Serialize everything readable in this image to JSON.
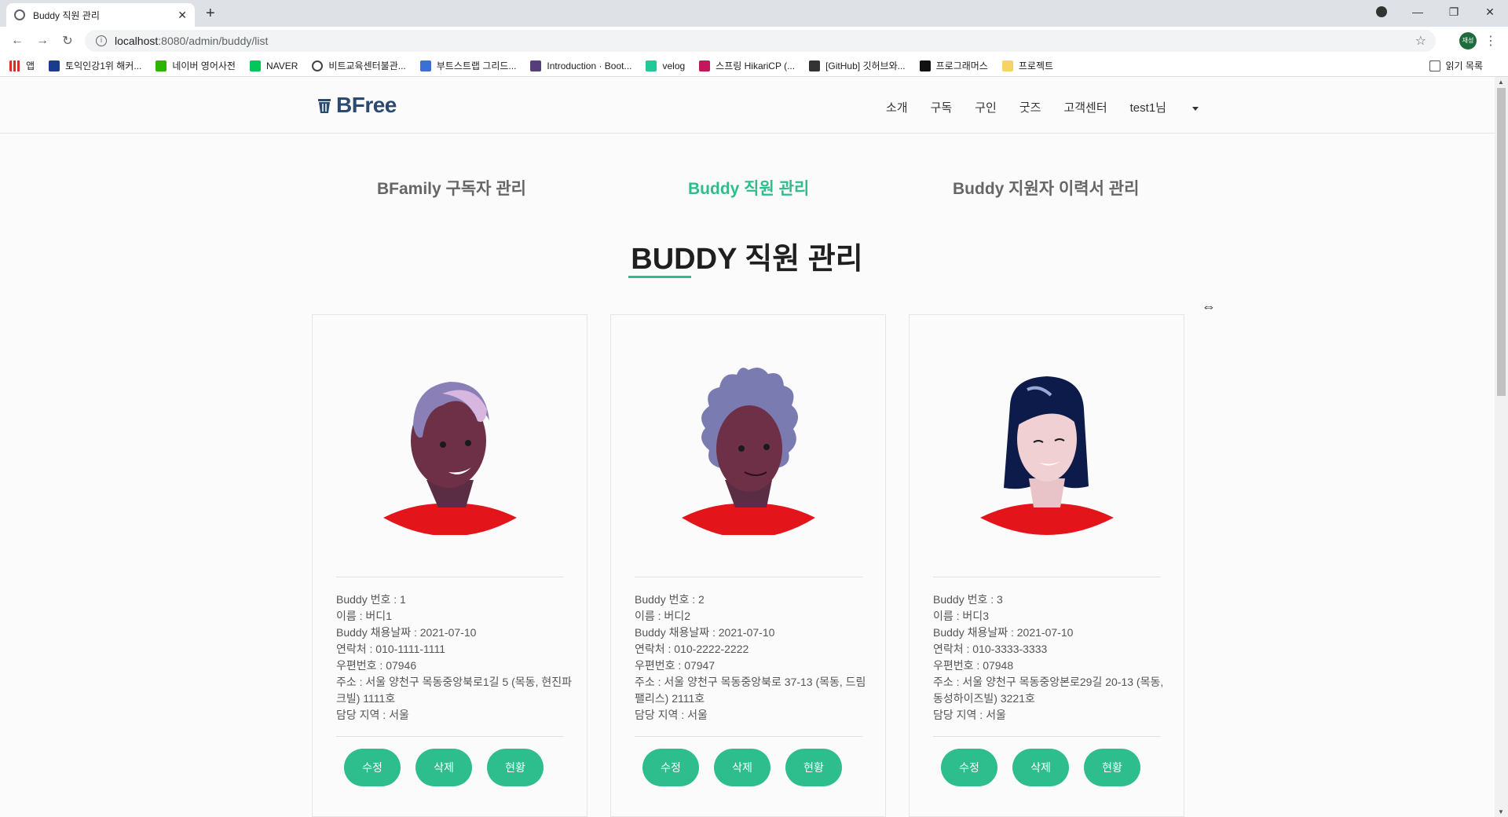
{
  "browser": {
    "tab_title": "Buddy 직원 관리",
    "url_host": "localhost",
    "url_path": ":8080/admin/buddy/list",
    "profile_initials": "재성",
    "bookmarks": [
      "앱",
      "토익인강1위 해커...",
      "네이버 영어사전",
      "NAVER",
      "비트교육센터불관...",
      "부트스트랩 그리드...",
      "Introduction · Boot...",
      "velog",
      "스프링 HikariCP (...",
      "[GitHub] 깃허브와...",
      "프로그래머스",
      "프로젝트"
    ],
    "reading_list": "읽기 목록"
  },
  "header": {
    "logo_text": "BFree",
    "menu": [
      "소개",
      "구독",
      "구인",
      "굿즈",
      "고객센터"
    ],
    "user": "test1님"
  },
  "subnav": {
    "items": [
      "BFamily 구독자 관리",
      "Buddy 직원 관리",
      "Buddy 지원자 이력서 관리"
    ],
    "active_index": 1
  },
  "page_title": "BUDDY 직원 관리",
  "cards": [
    {
      "no": "Buddy 번호 : 1",
      "name": "이름 : 버디1",
      "hire": "Buddy 채용날짜 : 2021-07-10",
      "phone": "연락처 : 010-1111-1111",
      "zip": "우편번호 : 07946",
      "addr": "주소 : 서울 양천구 목동중앙북로1길 5 (목동, 현진파크빌) 1111호",
      "region": "담당 지역 : 서울",
      "avatar": "avatar-elder-woman-icon"
    },
    {
      "no": "Buddy 번호 : 2",
      "name": "이름 : 버디2",
      "hire": "Buddy 채용날짜 : 2021-07-10",
      "phone": "연락처 : 010-2222-2222",
      "zip": "우편번호 : 07947",
      "addr": "주소 : 서울 양천구 목동중앙북로 37-13 (목동, 드림팰리스) 2111호",
      "region": "담당 지역 : 서울",
      "avatar": "avatar-curly-hair-icon"
    },
    {
      "no": "Buddy 번호 : 3",
      "name": "이름 : 버디3",
      "hire": "Buddy 채용날짜 : 2021-07-10",
      "phone": "연락처 : 010-3333-3333",
      "zip": "우편번호 : 07948",
      "addr": "주소 : 서울 양천구 목동중앙본로29길 20-13 (목동, 동성하이즈빌) 3221호",
      "region": "담당 지역 : 서울",
      "avatar": "avatar-black-hair-icon"
    }
  ],
  "buttons": {
    "edit": "수정",
    "delete": "삭제",
    "status": "현황"
  },
  "colors": {
    "accent": "#2ebd8c",
    "logo": "#2b4a6f",
    "shirt": "#e4141b"
  }
}
